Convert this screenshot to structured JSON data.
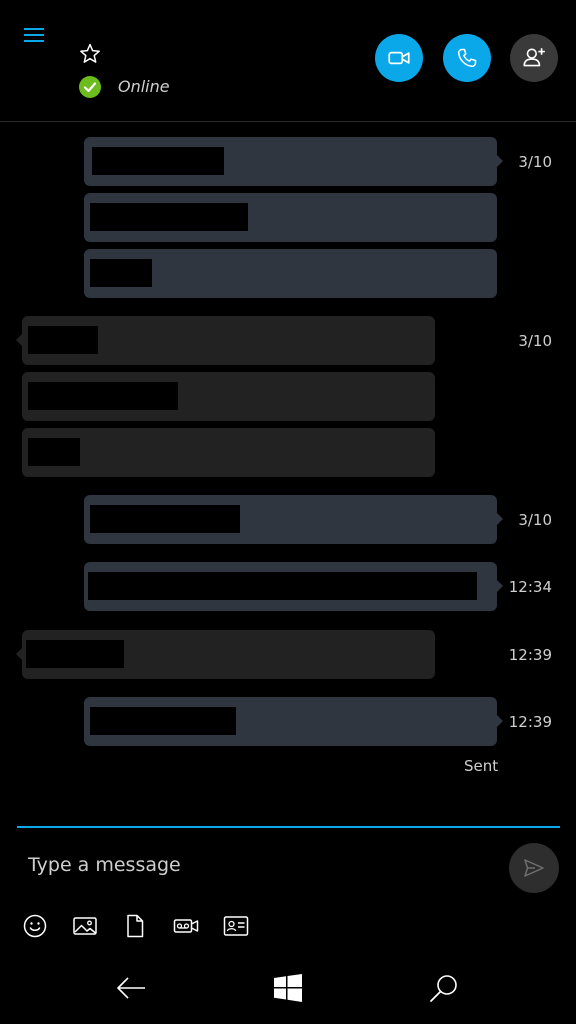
{
  "header": {
    "status_text": "Online",
    "accent_color": "#0aa7e9",
    "presence_color": "#6cbc1e",
    "icons": [
      "hamburger-menu-icon",
      "star-icon",
      "presence-check-icon",
      "video-call-icon",
      "phone-call-icon",
      "add-contact-icon"
    ]
  },
  "messages": {
    "timestamps": [
      "3/10",
      "3/10",
      "3/10",
      "12:34",
      "12:39",
      "12:39"
    ],
    "sent_label": "Sent",
    "outgoing_color": "#2f3640",
    "incoming_color": "#222222"
  },
  "composer": {
    "placeholder": "Type a message",
    "tools": [
      "emoji-icon",
      "image-icon",
      "file-icon",
      "video-message-icon",
      "contact-card-icon"
    ],
    "send_icon": "send-icon"
  },
  "system_nav": {
    "icons": [
      "back-arrow-icon",
      "windows-start-icon",
      "search-icon"
    ]
  }
}
